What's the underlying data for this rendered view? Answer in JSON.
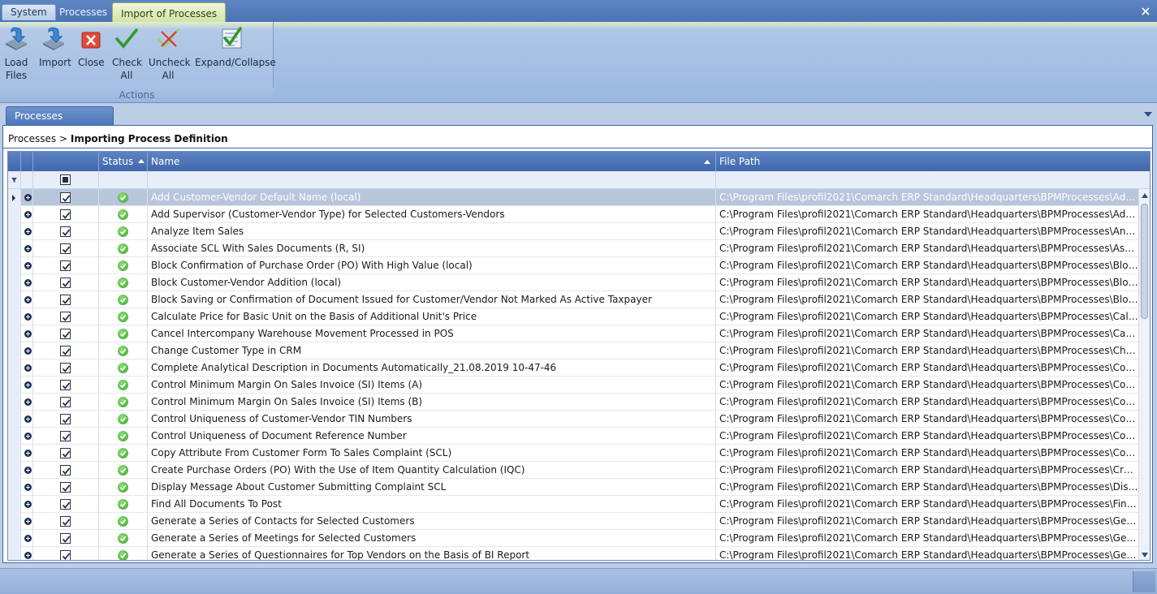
{
  "ribbon_tabs": [
    "System",
    "Processes",
    "Import of Processes"
  ],
  "ribbon": {
    "buttons": [
      {
        "line1": "Load",
        "line2": "Files",
        "icon": "load-files-icon"
      },
      {
        "line1": "Import",
        "line2": "",
        "icon": "import-icon"
      },
      {
        "line1": "Close",
        "line2": "",
        "icon": "close-icon"
      },
      {
        "line1": "Check",
        "line2": "All",
        "icon": "check-all-icon"
      },
      {
        "line1": "Uncheck",
        "line2": "All",
        "icon": "uncheck-all-icon"
      },
      {
        "line1": "Expand/Collapse",
        "line2": "",
        "icon": "expand-collapse-icon"
      }
    ],
    "group_label": "Actions"
  },
  "doc_tab": "Processes",
  "breadcrumb": {
    "parent": "Processes",
    "separator": ">",
    "current": "Importing Process Definition"
  },
  "grid": {
    "columns": {
      "status": "Status",
      "name": "Name",
      "path": "File Path"
    },
    "rows": [
      {
        "name": "Add Customer-Vendor Default Name (local)",
        "path": "C:\\Program Files\\profil2021\\Comarch ERP Standard\\Headquarters\\BPMProcesses\\Add Custom..."
      },
      {
        "name": "Add Supervisor (Customer-Vendor Type) for Selected Customers-Vendors",
        "path": "C:\\Program Files\\profil2021\\Comarch ERP Standard\\Headquarters\\BPMProcesses\\Add Supervis..."
      },
      {
        "name": "Analyze Item Sales",
        "path": "C:\\Program Files\\profil2021\\Comarch ERP Standard\\Headquarters\\BPMProcesses\\Analyze Item..."
      },
      {
        "name": "Associate SCL With Sales Documents (R, SI)",
        "path": "C:\\Program Files\\profil2021\\Comarch ERP Standard\\Headquarters\\BPMProcesses\\Associate SC..."
      },
      {
        "name": "Block Confirmation of Purchase Order (PO) With High Value (local)",
        "path": "C:\\Program Files\\profil2021\\Comarch ERP Standard\\Headquarters\\BPMProcesses\\Block Confir..."
      },
      {
        "name": "Block Customer-Vendor Addition (local)",
        "path": "C:\\Program Files\\profil2021\\Comarch ERP Standard\\Headquarters\\BPMProcesses\\Block Custo..."
      },
      {
        "name": "Block Saving or Confirmation of Document Issued for Customer/Vendor Not Marked As Active Taxpayer",
        "path": "C:\\Program Files\\profil2021\\Comarch ERP Standard\\Headquarters\\BPMProcesses\\Block Registr..."
      },
      {
        "name": "Calculate Price for Basic Unit on the Basis of Additional Unit's Price",
        "path": "C:\\Program Files\\profil2021\\Comarch ERP Standard\\Headquarters\\BPMProcesses\\Calculate Pri..."
      },
      {
        "name": "Cancel Intercompany Warehouse Movement Processed in POS",
        "path": "C:\\Program Files\\profil2021\\Comarch ERP Standard\\Headquarters\\BPMProcesses\\Cancel Interc..."
      },
      {
        "name": "Change Customer Type in CRM",
        "path": "C:\\Program Files\\profil2021\\Comarch ERP Standard\\Headquarters\\BPMProcesses\\Change Cust..."
      },
      {
        "name": "Complete Analytical Description in Documents Automatically_21.08.2019 10-47-46",
        "path": "C:\\Program Files\\profil2021\\Comarch ERP Standard\\Headquarters\\BPMProcesses\\Complete An..."
      },
      {
        "name": "Control Minimum Margin On Sales Invoice (SI) Items (A)",
        "path": "C:\\Program Files\\profil2021\\Comarch ERP Standard\\Headquarters\\BPMProcesses\\Control Mini..."
      },
      {
        "name": "Control Minimum Margin On Sales Invoice (SI) Items (B)",
        "path": "C:\\Program Files\\profil2021\\Comarch ERP Standard\\Headquarters\\BPMProcesses\\Control Mini..."
      },
      {
        "name": "Control Uniqueness of Customer-Vendor TIN Numbers",
        "path": "C:\\Program Files\\profil2021\\Comarch ERP Standard\\Headquarters\\BPMProcesses\\Control Uniq..."
      },
      {
        "name": "Control Uniqueness of Document Reference Number",
        "path": "C:\\Program Files\\profil2021\\Comarch ERP Standard\\Headquarters\\BPMProcesses\\Control Uniq..."
      },
      {
        "name": "Copy Attribute From Customer Form To Sales Complaint (SCL)",
        "path": "C:\\Program Files\\profil2021\\Comarch ERP Standard\\Headquarters\\BPMProcesses\\Copy Attribu..."
      },
      {
        "name": "Create Purchase Orders (PO) With the Use of Item Quantity Calculation (IQC)",
        "path": "C:\\Program Files\\profil2021\\Comarch ERP Standard\\Headquarters\\BPMProcesses\\Create Purch..."
      },
      {
        "name": "Display Message About Customer Submitting Complaint SCL",
        "path": "C:\\Program Files\\profil2021\\Comarch ERP Standard\\Headquarters\\BPMProcesses\\Display Mess..."
      },
      {
        "name": "Find All Documents To Post",
        "path": "C:\\Program Files\\profil2021\\Comarch ERP Standard\\Headquarters\\BPMProcesses\\Find All Docu..."
      },
      {
        "name": "Generate a Series of Contacts for Selected Customers",
        "path": "C:\\Program Files\\profil2021\\Comarch ERP Standard\\Headquarters\\BPMProcesses\\Generate a S..."
      },
      {
        "name": "Generate a Series of Meetings for Selected Customers",
        "path": "C:\\Program Files\\profil2021\\Comarch ERP Standard\\Headquarters\\BPMProcesses\\Generate a S..."
      },
      {
        "name": "Generate a Series of Questionnaires for Top Vendors on the Basis of BI Report",
        "path": "C:\\Program Files\\profil2021\\Comarch ERP Standard\\Headquarters\\BPMProcesses\\Generate a S..."
      }
    ]
  }
}
